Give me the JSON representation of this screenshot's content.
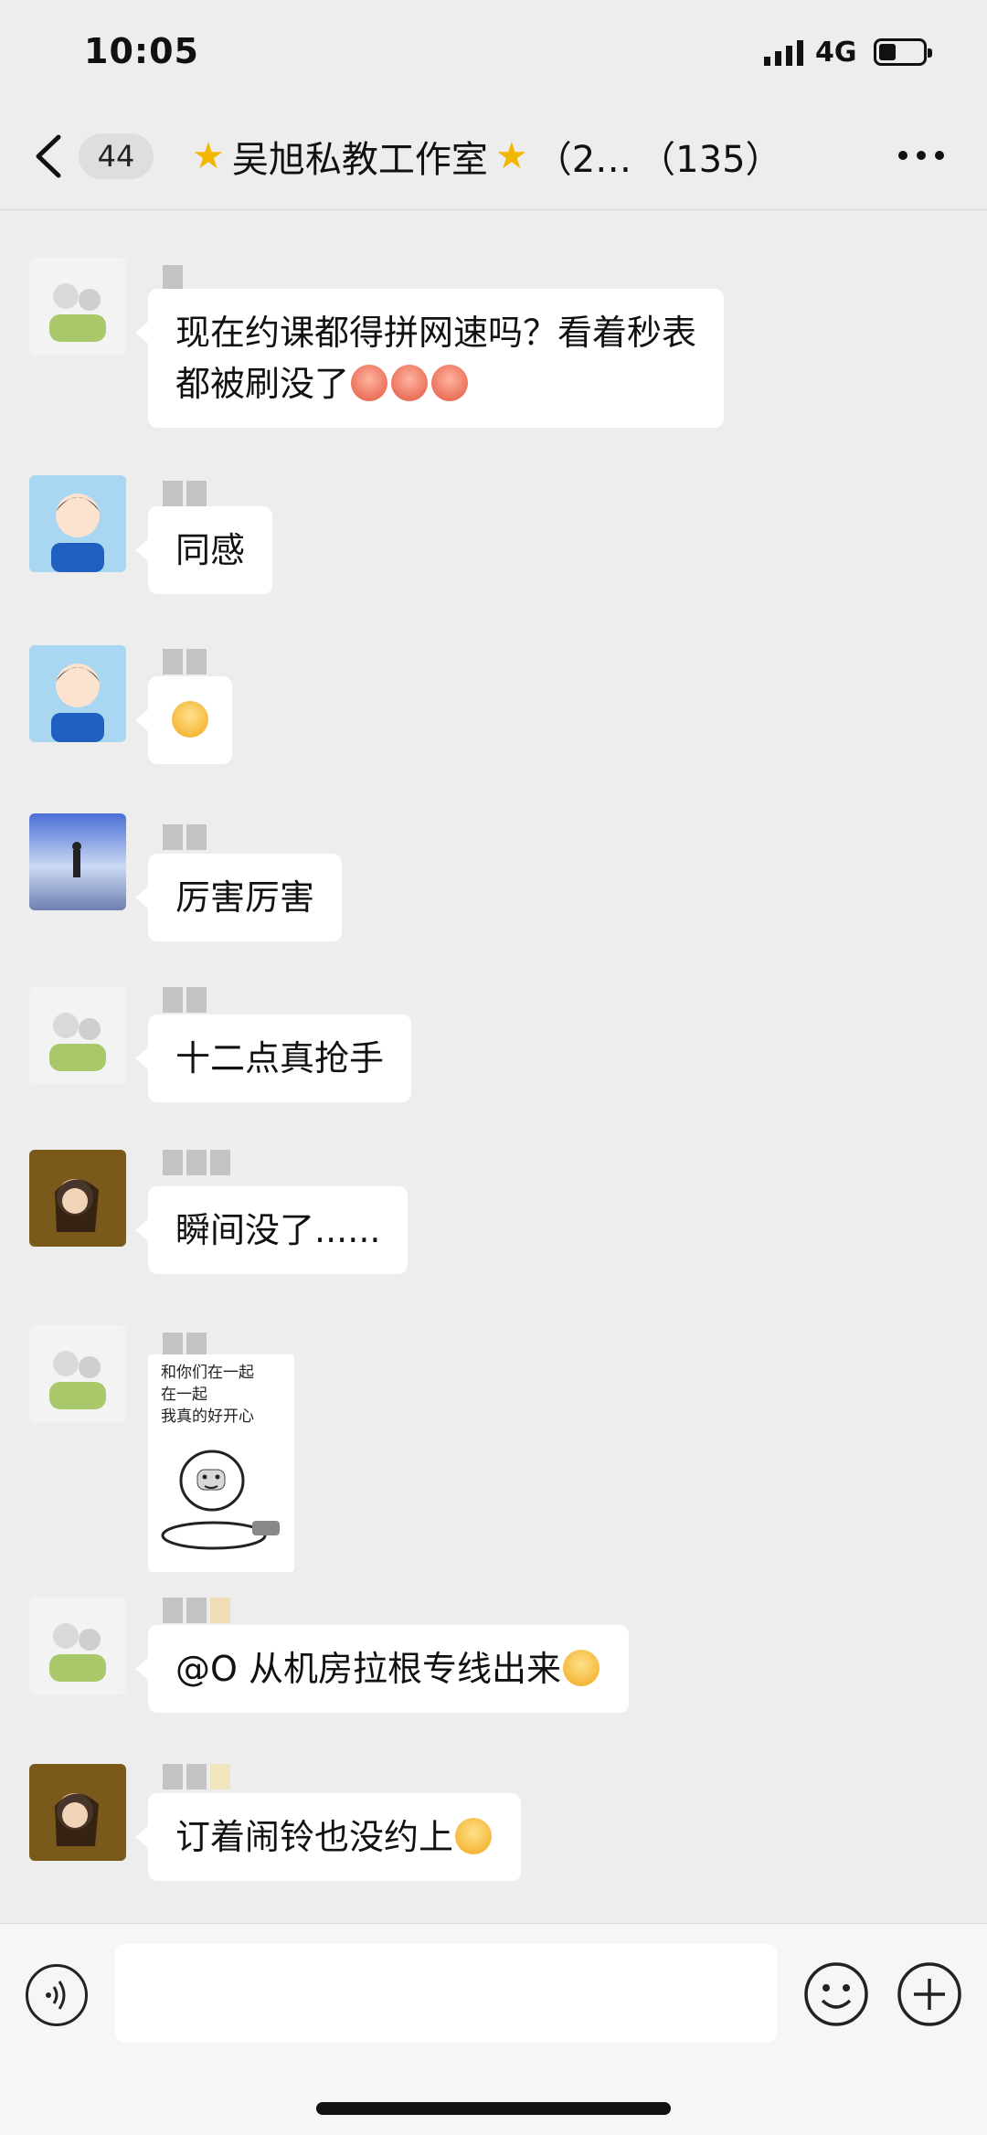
{
  "status": {
    "time": "10:05",
    "network": "4G"
  },
  "header": {
    "back_label": "back",
    "unread_count": "44",
    "title": "吴旭私教工作室",
    "title_suffix": "（2…",
    "member_count": "（135）"
  },
  "messages": [
    {
      "text_line1": "现在约课都得拼网速吗？看着秒表",
      "text_line2": "都被刷没了"
    },
    {
      "text": "同感"
    },
    {
      "text": ""
    },
    {
      "text": "厉害厉害"
    },
    {
      "text": "十二点真抢手"
    },
    {
      "text": "瞬间没了......"
    },
    {
      "sticker_line1": "和你们在一起",
      "sticker_line2": "在一起",
      "sticker_line3": "我真的好开心"
    },
    {
      "text": "@O 从机房拉根专线出来"
    },
    {
      "text": "订着闹铃也没约上"
    }
  ],
  "icons": {
    "back": "chevron-left-icon",
    "more": "more-dots-icon",
    "voice": "voice-icon",
    "emoji": "emoji-icon",
    "plus": "plus-icon"
  },
  "colors": {
    "background": "#ededed",
    "bubble": "#ffffff",
    "star": "#f2b600"
  }
}
